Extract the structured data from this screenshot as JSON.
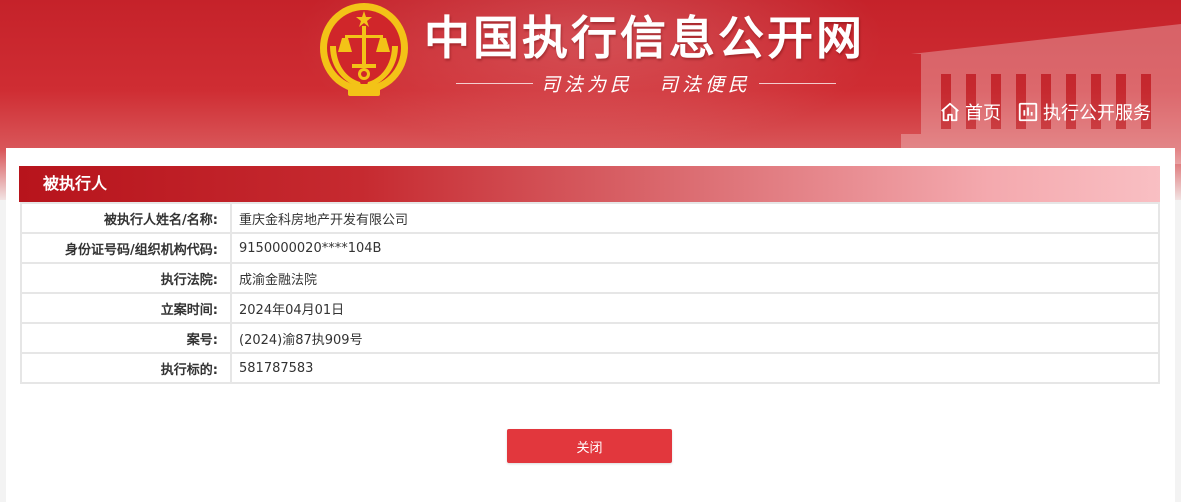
{
  "header": {
    "site_title": "中国执行信息公开网",
    "slogan_1": "司法为民",
    "slogan_2": "司法便民",
    "nav": {
      "home_label": "首页",
      "service_label": "执行公开服务"
    }
  },
  "section": {
    "title": "被执行人"
  },
  "rows": [
    {
      "label": "被执行人姓名/名称:",
      "value": "重庆金科房地产开发有限公司"
    },
    {
      "label": "身份证号码/组织机构代码:",
      "value": "9150000020****104B"
    },
    {
      "label": "执行法院:",
      "value": "成渝金融法院"
    },
    {
      "label": "立案时间:",
      "value": "2024年04月01日"
    },
    {
      "label": "案号:",
      "value": "(2024)渝87执909号"
    },
    {
      "label": "执行标的:",
      "value": "581787583"
    }
  ],
  "actions": {
    "close_label": "关闭"
  },
  "colors": {
    "brand_red": "#c5222a",
    "button_red": "#e2373d",
    "emblem_gold": "#f3c317"
  }
}
